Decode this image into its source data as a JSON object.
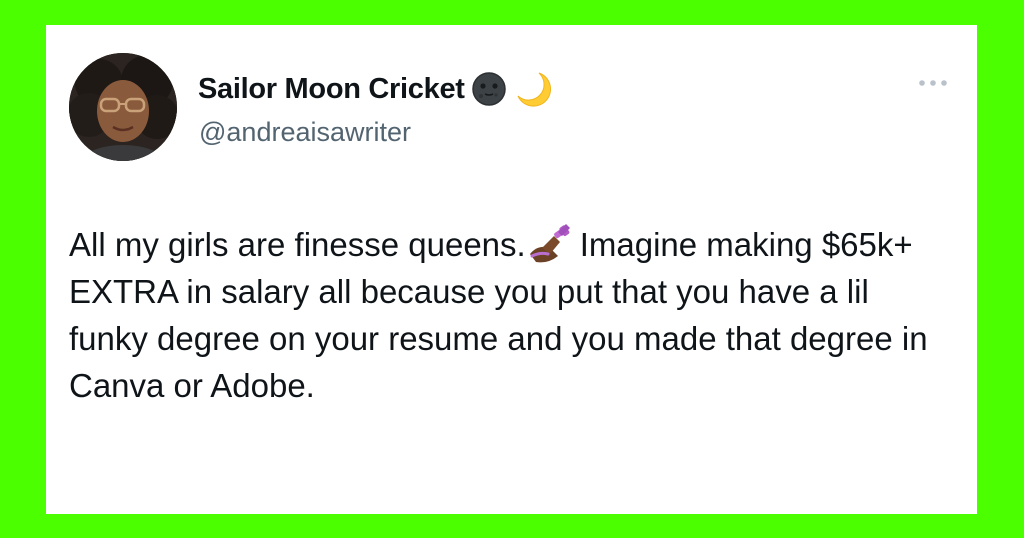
{
  "tweet": {
    "author": {
      "display_name": "Sailor Moon Cricket",
      "name_emojis": [
        "new-moon-face-icon",
        "crescent-moon-icon"
      ],
      "handle": "@andreaisawriter",
      "avatar": "profile-photo"
    },
    "more_icon": "more-options-icon",
    "text_before_emoji": "All my girls are finesse queens.",
    "inline_emoji": "nail-polish-icon",
    "text_after_emoji": "Imagine making $65k+ EXTRA in salary all because you put that you have a lil funky degree on your resume and you made that degree in Canva or Adobe."
  },
  "colors": {
    "frame_background": "#4cff00",
    "card_background": "#ffffff",
    "text_primary": "#0f1419",
    "text_secondary": "#536471"
  }
}
